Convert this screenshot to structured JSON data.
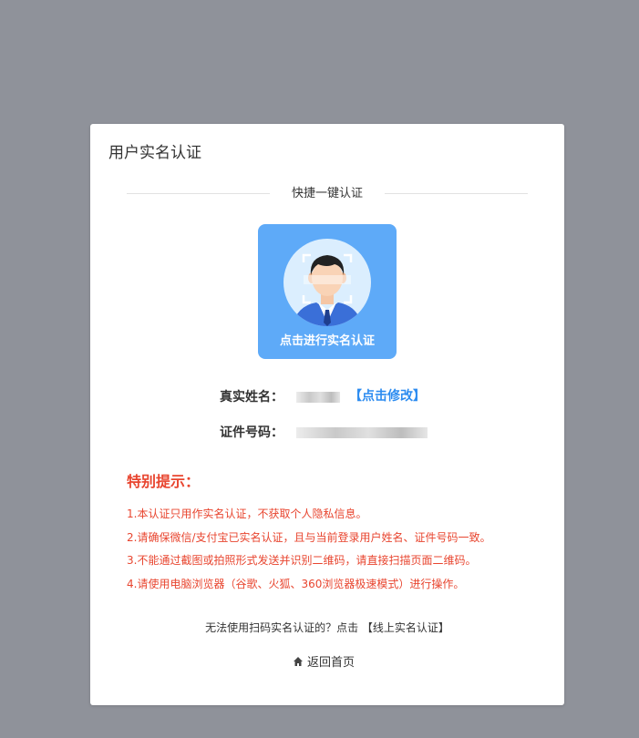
{
  "card": {
    "title": "用户实名认证"
  },
  "quick_auth": {
    "divider_label": "快捷一键认证",
    "button_label": "点击进行实名认证",
    "icon": "face-scan-icon"
  },
  "identity": {
    "name_label": "真实姓名：",
    "name_value": "",
    "edit_link": "【点击修改】",
    "id_label": "证件号码：",
    "id_value": ""
  },
  "notice": {
    "title": "特别提示：",
    "items": [
      "1.本认证只用作实名认证，不获取个人隐私信息。",
      "2.请确保微信/支付宝已实名认证，且与当前登录用户姓名、证件号码一致。",
      "3.不能通过截图或拍照形式发送并识别二维码，请直接扫描页面二维码。",
      "4.请使用电脑浏览器（谷歌、火狐、360浏览器极速模式）进行操作。"
    ]
  },
  "footer": {
    "online_prompt": "无法使用扫码实名认证的？点击",
    "online_link": "【线上实名认证】",
    "home_link": "返回首页",
    "home_icon": "home-icon"
  },
  "colors": {
    "backdrop": "#8f929a",
    "button_blue": "#5eaaf8",
    "link_blue": "#2d8cf0",
    "notice_red": "#e8452f"
  }
}
